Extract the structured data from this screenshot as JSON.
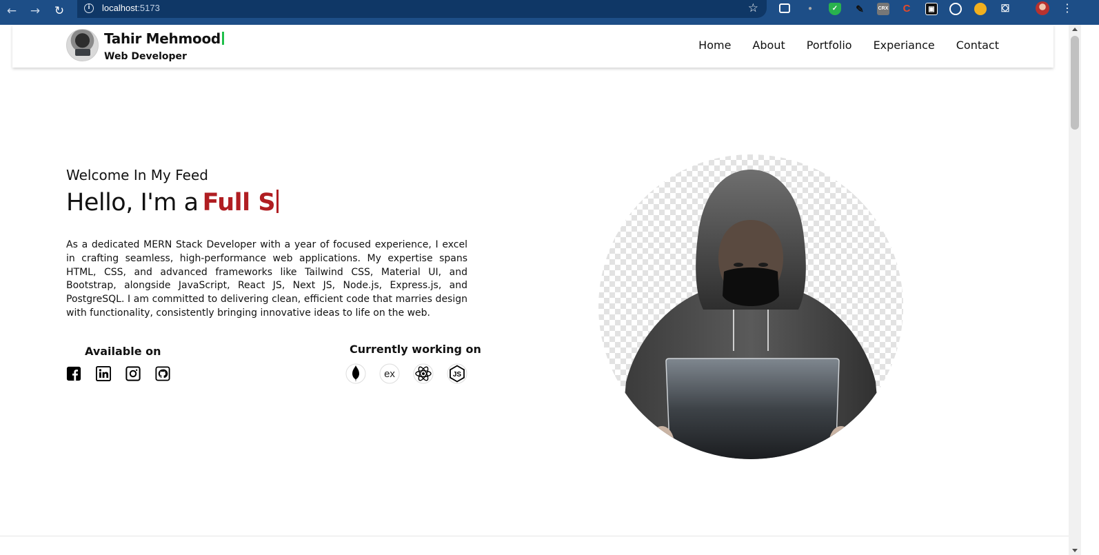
{
  "browser": {
    "url_host": "localhost",
    "url_port": ":5173"
  },
  "header": {
    "name": "Tahir Mehmood",
    "role": "Web Developer",
    "nav": [
      "Home",
      "About",
      "Portfolio",
      "Experiance",
      "Contact"
    ]
  },
  "hero": {
    "welcome": "Welcome In My Feed",
    "hello": "Hello, I'm a",
    "typed_role": "Full S",
    "description": "As a dedicated MERN Stack Developer with a year of focused experience, I excel in crafting seamless, high-performance web applications. My expertise spans HTML, CSS, and advanced frameworks like Tailwind CSS, Material UI, and Bootstrap, alongside JavaScript, React JS, Next JS, Node.js, Express.js, and PostgreSQL. I am committed to delivering clean, efficient code that marries design with functionality, consistently bringing innovative ideas to life on the web.",
    "available_title": "Available on",
    "working_title": "Currently working on",
    "social_icons": [
      "facebook-icon",
      "linkedin-icon",
      "instagram-icon",
      "github-icon"
    ],
    "tech_icons": [
      "mongodb-icon",
      "express-icon",
      "react-icon",
      "nodejs-icon"
    ],
    "tech_express_text": "ex",
    "tech_js_text": "JS"
  },
  "colors": {
    "accent_red": "#b01e22",
    "caret_green": "#1fbf4a",
    "chrome_blue": "#1d4e87"
  }
}
